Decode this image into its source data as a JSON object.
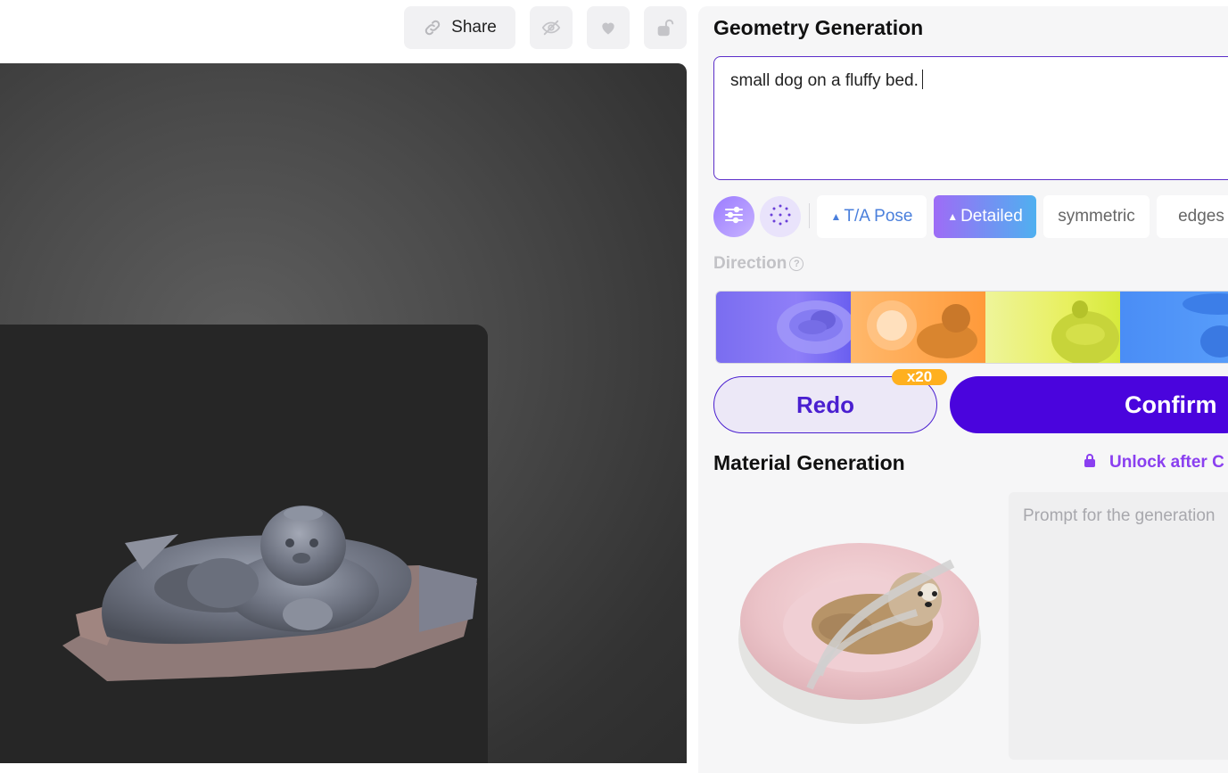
{
  "toolbar": {
    "share_label": "Share",
    "icons": [
      "link-icon",
      "eye-slash-icon",
      "heart-icon",
      "unlock-icon"
    ]
  },
  "geometry": {
    "title": "Geometry Generation",
    "prompt_value": "small dog on a fluffy bed.",
    "tool_icons": [
      "sliders-icon",
      "dots-circle-icon"
    ],
    "chips": {
      "pose": "T/A Pose",
      "detailed": "Detailed",
      "symmetric": "symmetric",
      "edges": "edges"
    },
    "direction_label": "Direction",
    "redo_label": "Redo",
    "redo_badge": "x20",
    "confirm_label": "Confirm"
  },
  "material": {
    "title": "Material Generation",
    "unlock_label": "Unlock after C",
    "prompt_placeholder": "Prompt for the generation"
  },
  "colors": {
    "accent": "#4a04dd",
    "badge": "#ffb01f",
    "unlock": "#8a3ff0"
  }
}
